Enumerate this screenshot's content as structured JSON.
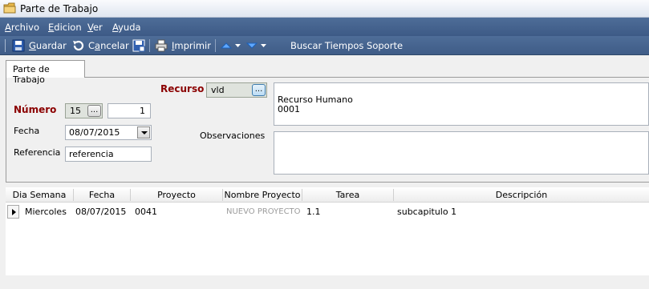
{
  "window": {
    "title": "Parte de Trabajo"
  },
  "menu": [
    {
      "accel": "A",
      "rest": "rchivo"
    },
    {
      "accel": "E",
      "rest": "dicion"
    },
    {
      "accel": "V",
      "rest": "er"
    },
    {
      "accel": "A",
      "rest": "yuda"
    }
  ],
  "toolbar": {
    "guardar": {
      "accel": "G",
      "rest": "uardar"
    },
    "cancelar": {
      "pre": "C",
      "accel": "a",
      "rest": "ncelar"
    },
    "imprimir": {
      "accel": "I",
      "rest": "mprimir"
    },
    "buscar": "Buscar Tiempos Soporte"
  },
  "tab": {
    "label": "Parte de Trabajo"
  },
  "form": {
    "numero_label": "Número",
    "numero_serie": "15",
    "numero_value": "1",
    "fecha_label": "Fecha",
    "fecha_value": "08/07/2015",
    "referencia_label": "Referencia",
    "referencia_value": "referencia",
    "recurso_label": "Recurso",
    "recurso_value": "vld",
    "recurso_desc_line1": "Recurso Humano",
    "recurso_desc_line2": "0001",
    "observaciones_label": "Observaciones",
    "observaciones_value": "",
    "dots": "..."
  },
  "grid": {
    "columns": [
      "Dia Semana",
      "Fecha",
      "Proyecto",
      "Nombre Proyecto",
      "Tarea",
      "Descripción"
    ],
    "rows": [
      {
        "dia": "Miercoles",
        "fecha": "08/07/2015",
        "proyecto": "0041",
        "nombre": "NUEVO PROYECTO",
        "tarea": "1.1",
        "descripcion": "subcapitulo 1"
      }
    ]
  }
}
